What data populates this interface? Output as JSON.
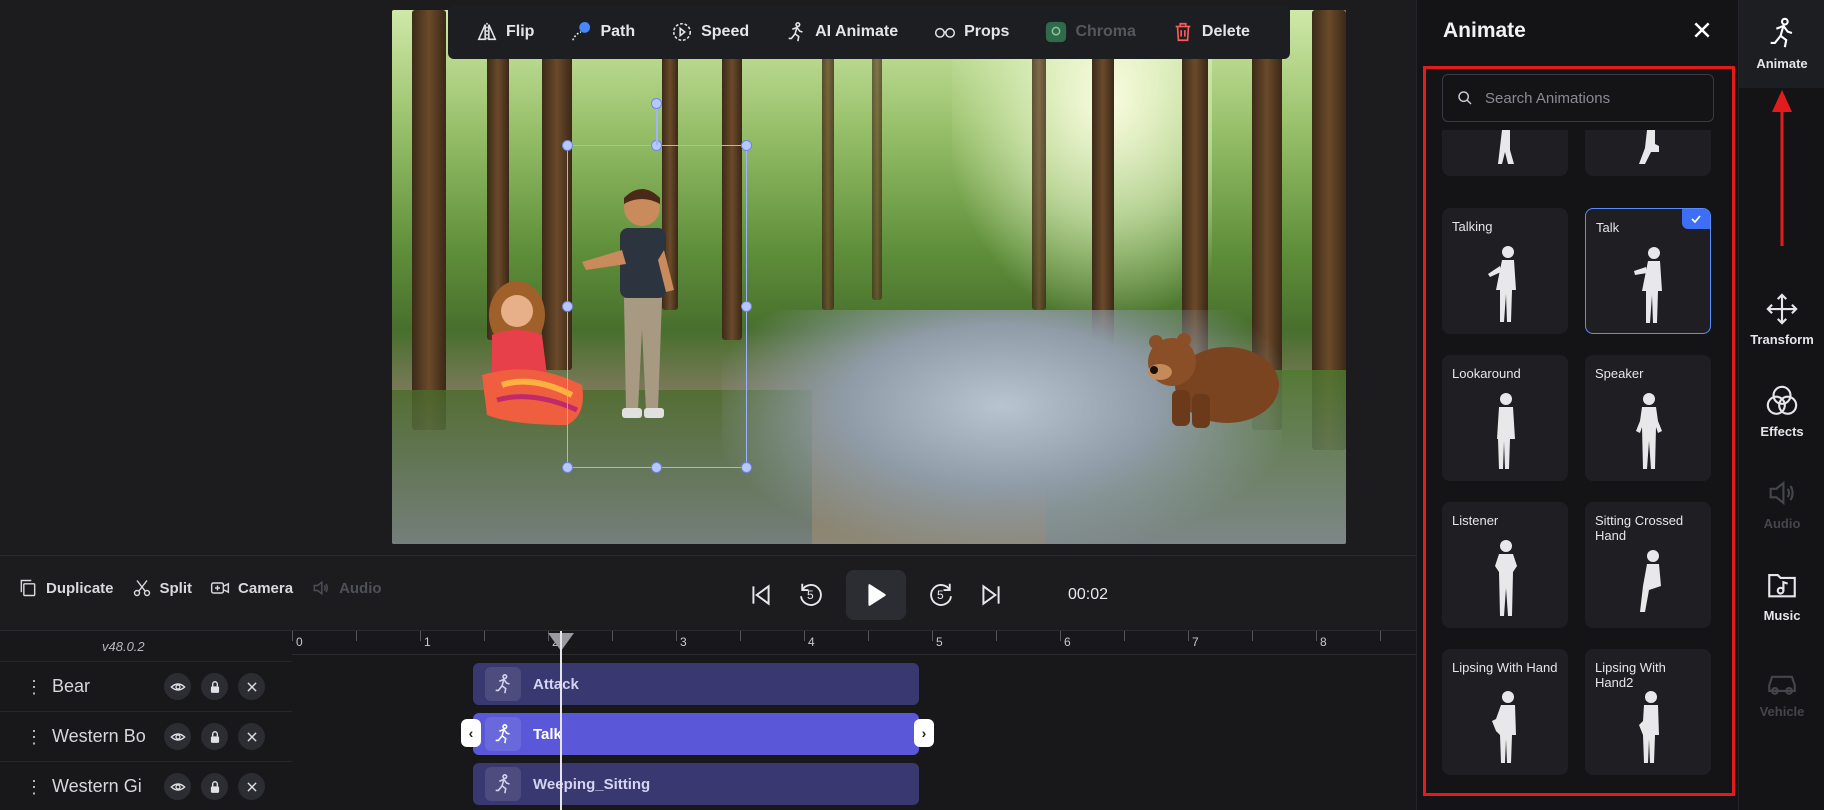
{
  "toolbar": {
    "flip": "Flip",
    "path": "Path",
    "speed": "Speed",
    "ai_animate": "AI Animate",
    "props": "Props",
    "chroma": "Chroma",
    "delete": "Delete"
  },
  "controls": {
    "duplicate": "Duplicate",
    "split": "Split",
    "camera": "Camera",
    "audio": "Audio",
    "rewind_5": "5",
    "forward_5": "5",
    "time": "00:02"
  },
  "timeline": {
    "version": "v48.0.2",
    "ticks": [
      "0",
      "1",
      "2",
      "3",
      "4",
      "5",
      "6",
      "7",
      "8"
    ],
    "tracks": [
      {
        "name": "Bear",
        "clip": "Attack"
      },
      {
        "name": "Western Bo",
        "clip": "Talk"
      },
      {
        "name": "Western Gi",
        "clip": "Weeping_Sitting"
      }
    ]
  },
  "panel": {
    "title": "Animate",
    "search_placeholder": "Search Animations",
    "cards": [
      {
        "label": ""
      },
      {
        "label": ""
      },
      {
        "label": "Talking"
      },
      {
        "label": "Talk",
        "selected": true
      },
      {
        "label": "Lookaround"
      },
      {
        "label": "Speaker"
      },
      {
        "label": "Listener"
      },
      {
        "label": "Sitting Crossed Hand"
      },
      {
        "label": "Lipsing With Hand"
      },
      {
        "label": "Lipsing With Hand2"
      }
    ]
  },
  "rail": {
    "animate": "Animate",
    "transform": "Transform",
    "effects": "Effects",
    "audio": "Audio",
    "music": "Music",
    "vehicle": "Vehicle"
  },
  "colors": {
    "accent": "#5a58d8",
    "highlight_box": "#e21c1c",
    "selected_card_border": "#5a8cff",
    "delete": "#ff5a5a"
  }
}
